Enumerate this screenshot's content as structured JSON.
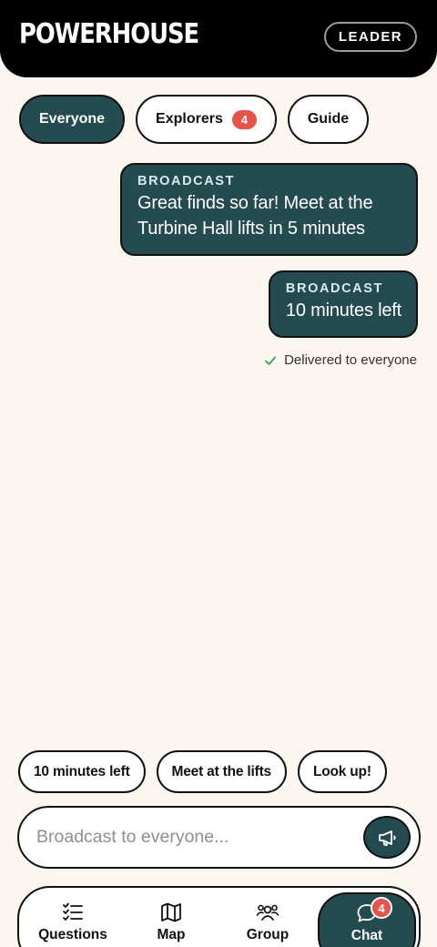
{
  "header": {
    "logo": "POWERHOUSE",
    "role_badge": "LEADER"
  },
  "tabs": [
    {
      "label": "Everyone",
      "active": true
    },
    {
      "label": "Explorers",
      "count": "4"
    },
    {
      "label": "Guide"
    }
  ],
  "messages": [
    {
      "kicker": "BROADCAST",
      "body": "Great finds so far! Meet at the Turbine Hall lifts in 5 minutes"
    },
    {
      "kicker": "BROADCAST",
      "body": "10 minutes left"
    }
  ],
  "status": {
    "delivered": "Delivered to everyone"
  },
  "quick_replies": [
    "10 minutes left",
    "Meet at the lifts",
    "Look up!"
  ],
  "composer": {
    "placeholder": "Broadcast to everyone...",
    "value": "",
    "send_icon": "megaphone-icon"
  },
  "nav": [
    {
      "label": "Questions",
      "icon": "checklist-icon"
    },
    {
      "label": "Map",
      "icon": "map-icon"
    },
    {
      "label": "Group",
      "icon": "group-icon"
    },
    {
      "label": "Chat",
      "icon": "chat-bubble-icon",
      "badge": "4",
      "active": true
    }
  ],
  "colors": {
    "primary": "#244b4f",
    "accent": "#e5534b",
    "background": "#fbf6f0",
    "header": "#000000",
    "success": "#3aa35b"
  }
}
